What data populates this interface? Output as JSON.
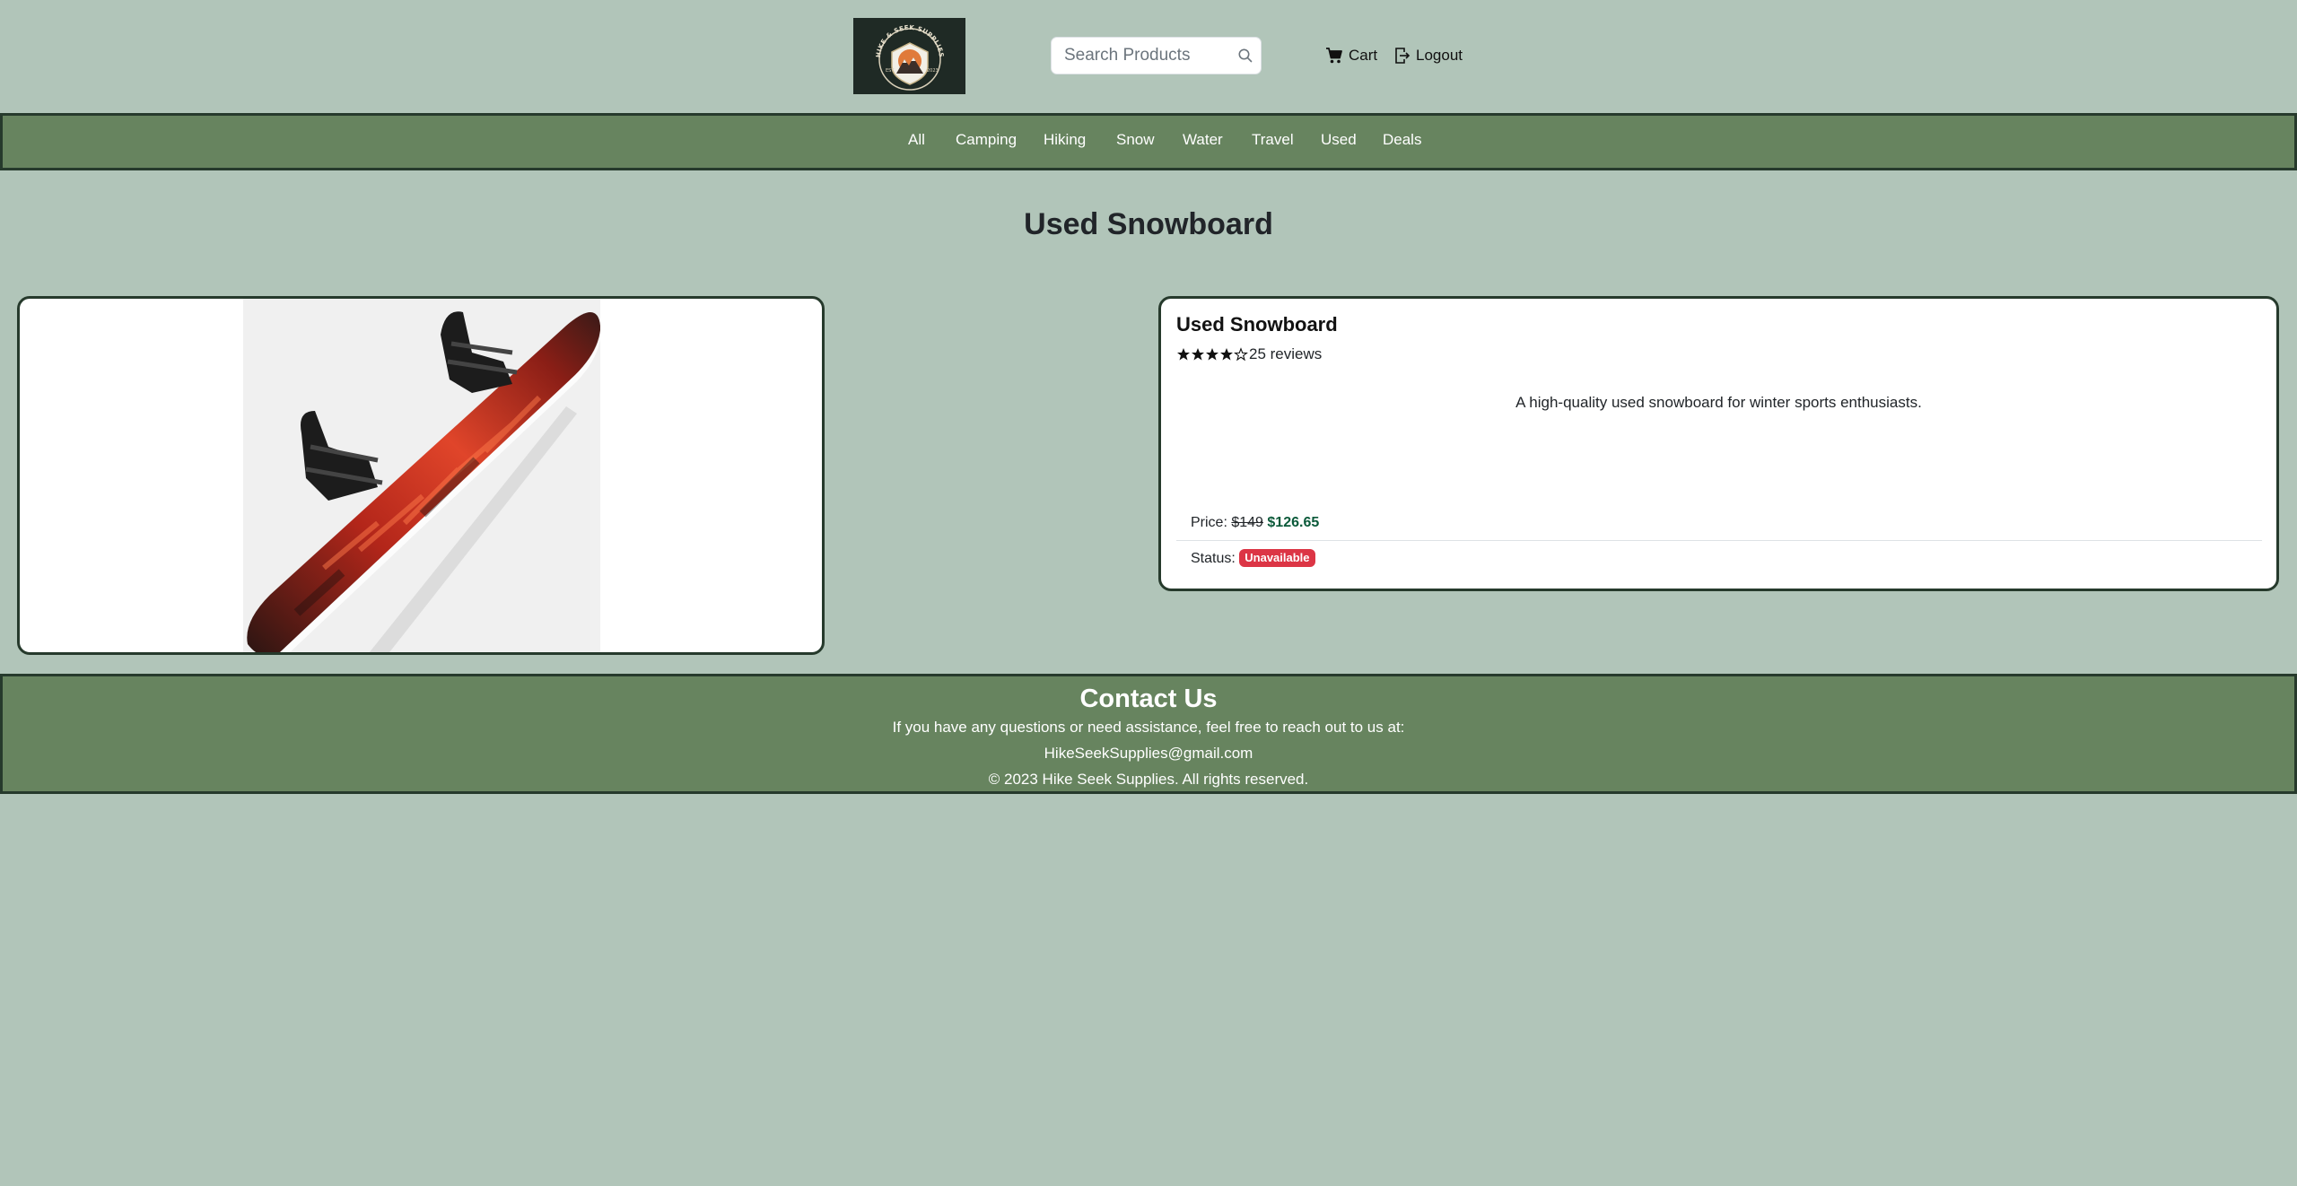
{
  "header": {
    "logo_text": "HIKE & SEEK SUPPLIES",
    "logo_est": "EST.",
    "logo_year": "2023",
    "search_placeholder": "Search Products",
    "cart_label": "Cart",
    "logout_label": "Logout"
  },
  "nav": {
    "items": [
      {
        "label": "All"
      },
      {
        "label": "Camping"
      },
      {
        "label": "Hiking"
      },
      {
        "label": "Snow"
      },
      {
        "label": "Water"
      },
      {
        "label": "Travel"
      },
      {
        "label": "Used"
      },
      {
        "label": "Deals"
      }
    ]
  },
  "page": {
    "title": "Used Snowboard"
  },
  "product": {
    "image_icon": "snowboard-image",
    "name": "Used Snowboard",
    "rating": 4,
    "rating_max": 5,
    "reviews_text": "25 reviews",
    "description": "A high-quality used snowboard for winter sports enthusiasts.",
    "price_label": "Price:",
    "old_price": "$149",
    "new_price": "$126.65",
    "status_label": "Status:",
    "status_value": "Unavailable"
  },
  "footer": {
    "title": "Contact Us",
    "message": "If you have any questions or need assistance, feel free to reach out to us at:",
    "email": "HikeSeekSupplies@gmail.com",
    "copyright": "© 2023 Hike Seek Supplies. All rights reserved."
  },
  "colors": {
    "page_bg": "#b1c5b9",
    "nav_bg": "#67845f",
    "border": "#263a2c",
    "new_price": "#0b5a3a",
    "badge_unavailable": "#dc3545"
  }
}
